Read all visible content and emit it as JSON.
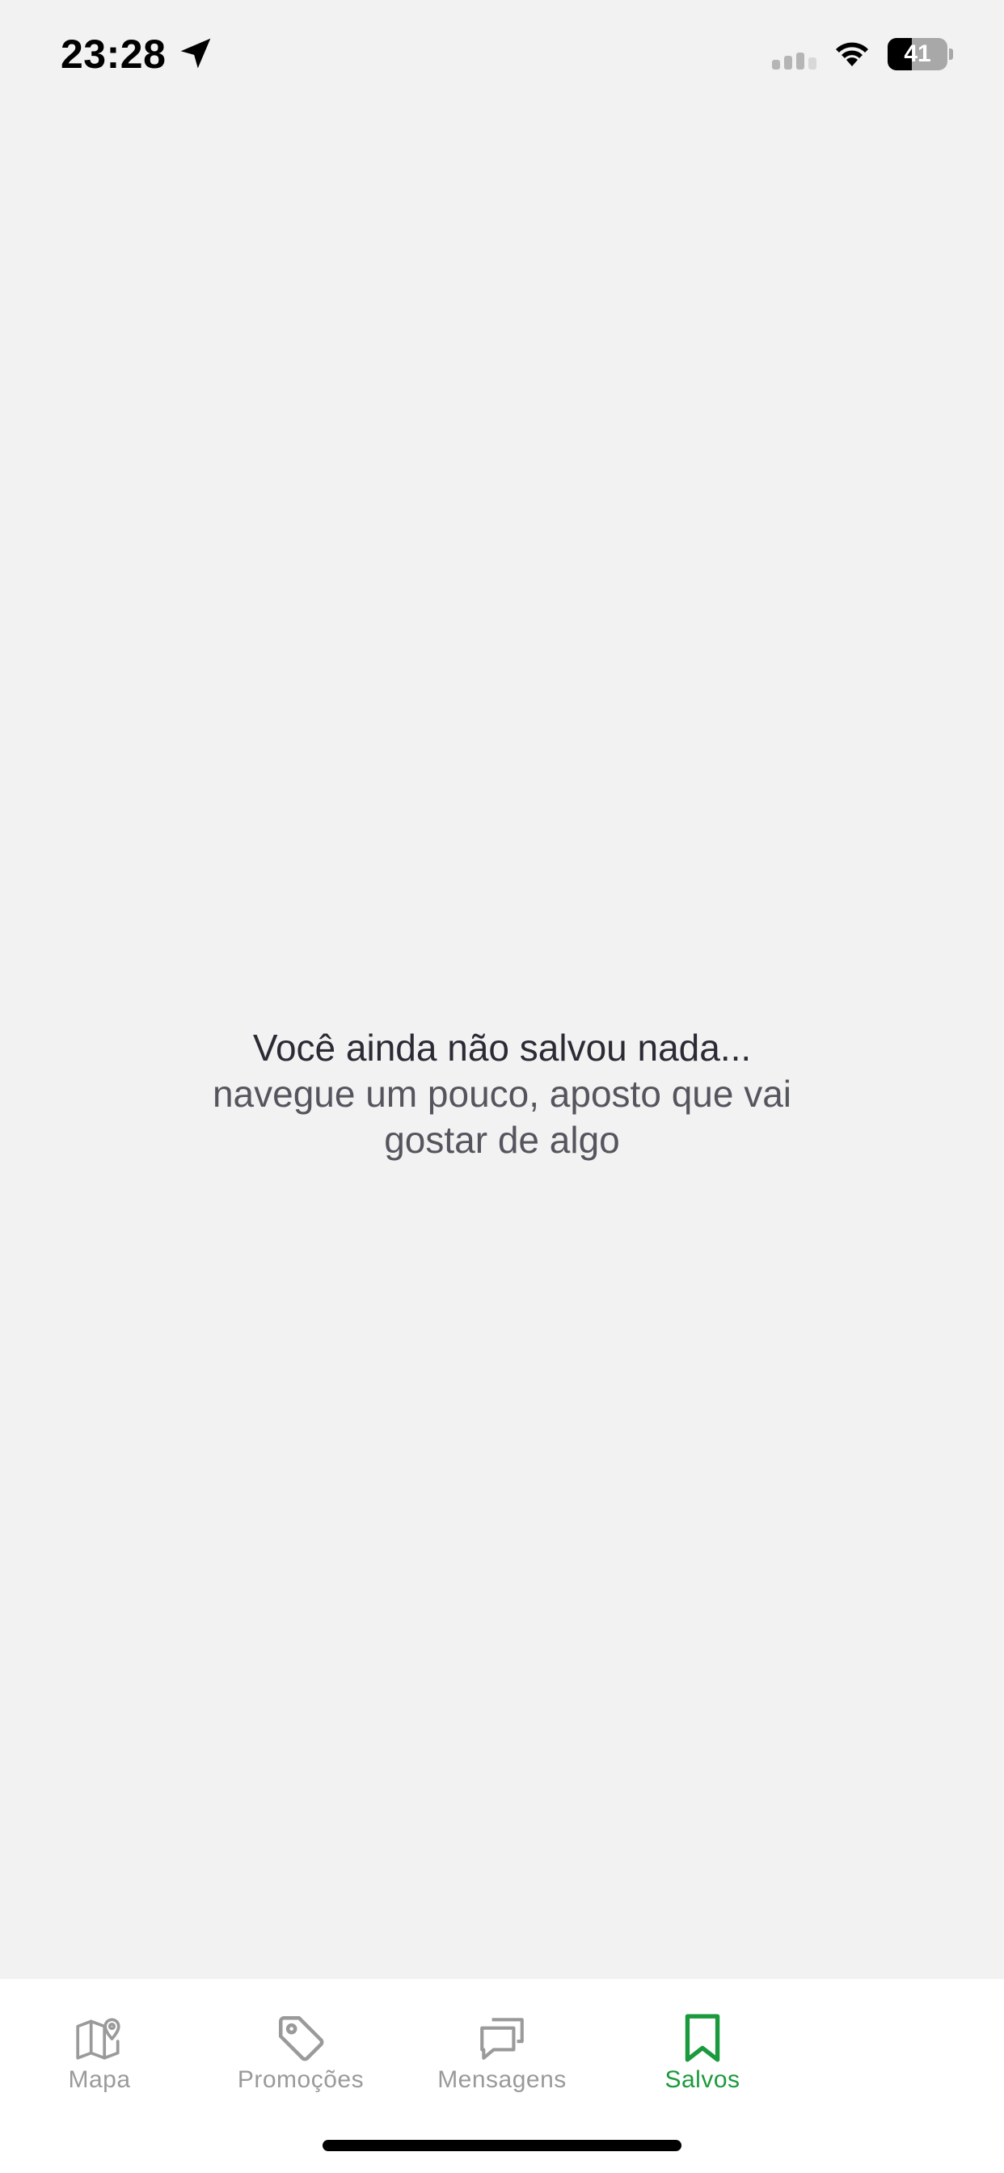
{
  "status_bar": {
    "time": "23:28",
    "battery_level": "41",
    "battery_fraction": 0.41
  },
  "empty_state": {
    "title": "Você ainda não salvou nada...",
    "subtitle": "navegue um pouco, aposto que vai gostar de algo"
  },
  "tab_bar": {
    "active_tab": "Salvos",
    "active_color": "#1a9a3c",
    "inactive_color": "#9a9a9a",
    "tabs": [
      {
        "label": "Mapa",
        "icon": "map-pin-icon"
      },
      {
        "label": "Promoções",
        "icon": "tag-icon"
      },
      {
        "label": "Mensagens",
        "icon": "messages-icon"
      },
      {
        "label": "Salvos",
        "icon": "bookmark-icon"
      }
    ]
  }
}
